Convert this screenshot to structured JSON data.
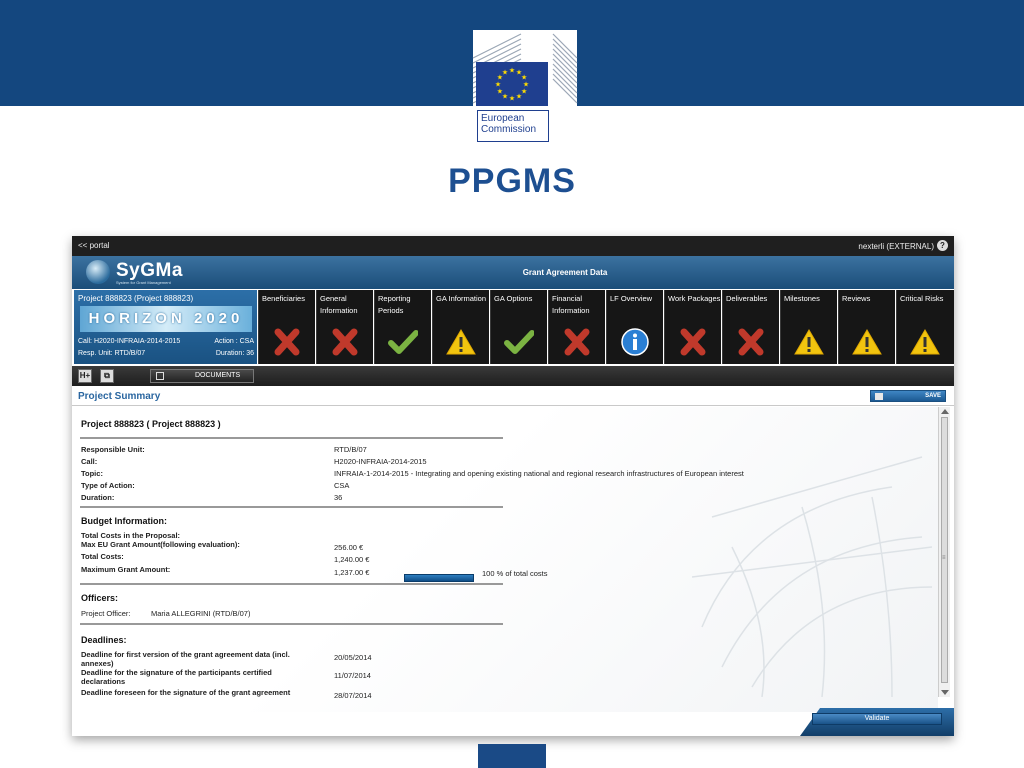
{
  "slide": {
    "org_line1": "European",
    "org_line2": "Commission",
    "title": "PPGMS"
  },
  "app": {
    "portal_link": "<< portal",
    "user": "nexterli (EXTERNAL)",
    "help": "?",
    "logo_name": "SyGMa",
    "logo_sub": "System for Grant Management",
    "header_title": "Grant Agreement Data"
  },
  "project_panel": {
    "title": "Project 888823 (Project 888823)",
    "horizon": "HORIZON 2020",
    "call": "Call: H2020-INFRAIA-2014-2015",
    "action": "Action : CSA",
    "resp_unit": "Resp. Unit: RTD/B/07",
    "duration": "Duration: 36"
  },
  "tabs": [
    {
      "label": "Beneficiaries",
      "status": "error"
    },
    {
      "label": "General Information",
      "status": "error"
    },
    {
      "label": "Reporting Periods",
      "status": "ok"
    },
    {
      "label": "GA Information",
      "status": "warning"
    },
    {
      "label": "GA Options",
      "status": "ok"
    },
    {
      "label": "Financial Information",
      "status": "error"
    },
    {
      "label": "LF Overview",
      "status": "info"
    },
    {
      "label": "Work Packages",
      "status": "error"
    },
    {
      "label": "Deliverables",
      "status": "error"
    },
    {
      "label": "Milestones",
      "status": "warning"
    },
    {
      "label": "Reviews",
      "status": "warning"
    },
    {
      "label": "Critical Risks",
      "status": "warning"
    }
  ],
  "toolbar": {
    "btn1": "H+",
    "btn2": "⧉",
    "documents": "DOCUMENTS"
  },
  "summary": {
    "title": "Project Summary",
    "save": "SAVE",
    "project_heading": "Project 888823 ( Project 888823 )",
    "general": {
      "rows": [
        {
          "label": "Responsible Unit:",
          "value": "RTD/B/07"
        },
        {
          "label": "Call:",
          "value": "H2020-INFRAIA-2014-2015"
        },
        {
          "label": "Topic:",
          "value": "INFRAIA-1-2014-2015 - Integrating and opening existing national and regional research infrastructures of European interest"
        },
        {
          "label": "Type of Action:",
          "value": "CSA"
        },
        {
          "label": "Duration:",
          "value": "36"
        }
      ]
    },
    "budget": {
      "heading": "Budget Information:",
      "total_costs_proposal": "Total Costs in the Proposal:",
      "max_eu_grant": "Max EU Grant Amount(following evaluation):",
      "max_eu_grant_value": "256.00 €",
      "total_costs": "Total Costs:",
      "total_costs_value": "1,240.00 €",
      "max_grant": "Maximum Grant Amount:",
      "max_grant_value": "1,237.00 €",
      "percent_text": "100 % of total costs",
      "percent": 100
    },
    "officers": {
      "heading": "Officers:",
      "label": "Project Officer:",
      "value": "Maria ALLEGRINI (RTD/B/07)"
    },
    "deadlines": {
      "heading": "Deadlines:",
      "rows": [
        {
          "label1": "Deadline for first version of the grant agreement data (incl.",
          "label2": "annexes)",
          "value": "20/05/2014"
        },
        {
          "label1": "Deadline for the signature of the participants certified",
          "label2": "declarations",
          "value": "11/07/2014"
        },
        {
          "label1": "Deadline foreseen for the signature of the grant agreement",
          "label2": "",
          "value": "28/07/2014"
        }
      ]
    },
    "validate": "Validate"
  },
  "colors": {
    "banner": "#14477f",
    "title": "#1d4f91",
    "error": "#c0392b",
    "ok": "#7bb342",
    "warning": "#f1c40f",
    "info": "#2a7fd4"
  }
}
